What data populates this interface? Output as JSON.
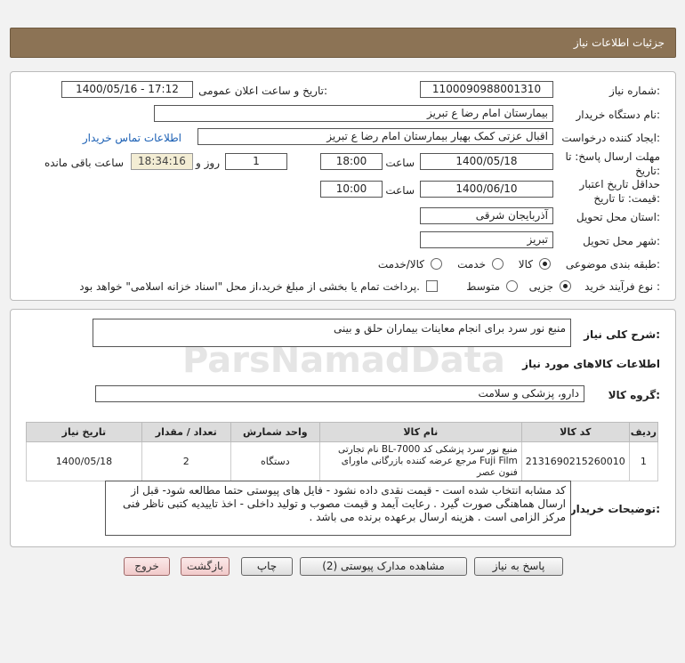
{
  "header": {
    "title": "جزئیات اطلاعات نیاز"
  },
  "watermark": {
    "text": "ParsNamadData"
  },
  "form": {
    "need_number": {
      "label": "شماره نیاز:",
      "value": "1100090988001310"
    },
    "announce_date": {
      "label": "تاریخ و ساعت اعلان عمومی:",
      "value": "1400/05/16 - 17:12"
    },
    "buyer_org": {
      "label": "نام دستگاه خریدار:",
      "value": "بیمارستان امام رضا  ع  تبریز"
    },
    "requester": {
      "label": "ایجاد کننده درخواست:",
      "value": "اقبال عزتی کمک بهیار بیمارستان امام رضا  ع  تبریز",
      "contact_link": "اطلاعات تماس خریدار"
    },
    "deadline": {
      "label": "مهلت ارسال پاسخ: تا تاریخ:",
      "date": "1400/05/18",
      "time_label": "ساعت",
      "time": "18:00",
      "days": "1",
      "days_label": "روز و",
      "remaining": "18:34:16",
      "remaining_label": "ساعت باقی مانده"
    },
    "validity": {
      "label": "حداقل تاریخ اعتبار قیمت: تا تاریخ:",
      "date": "1400/06/10",
      "time_label": "ساعت",
      "time": "10:00"
    },
    "province": {
      "label": "استان محل تحویل:",
      "value": "آذربایجان شرقی"
    },
    "city": {
      "label": "شهر محل تحویل:",
      "value": "تبریز"
    },
    "category": {
      "label": "طبقه بندی موضوعی:",
      "options": [
        "کالا",
        "خدمت",
        "کالا/خدمت"
      ],
      "selected": "کالا"
    },
    "process": {
      "label": "نوع فرآیند خرید :",
      "options": [
        "جزیی",
        "متوسط"
      ],
      "selected": "جزیی",
      "checkbox_text": "پرداخت تمام یا بخشی از مبلغ خرید،از محل \"اسناد خزانه اسلامی\" خواهد بود."
    }
  },
  "summary": {
    "label": "شرح کلی نیاز:",
    "value": "منبع نور سرد برای انجام معاینات بیماران حلق و بینی"
  },
  "goods_section_title": "اطلاعات کالاهای مورد نیاز",
  "goods_group": {
    "label": "گروه کالا:",
    "value": "دارو، پزشکی و سلامت"
  },
  "table": {
    "headers": [
      "ردیف",
      "کد کالا",
      "نام کالا",
      "واحد شمارش",
      "تعداد / مقدار",
      "تاریخ نیاز"
    ],
    "rows": [
      {
        "row": "1",
        "code": "2131690215260010",
        "name": "منبع نور سرد پزشکی کد BL-7000 نام تجارتی Fuji Film مرجع عرضه کننده بازرگانی ماورای فنون عصر",
        "unit": "دستگاه",
        "qty": "2",
        "date": "1400/05/18"
      }
    ]
  },
  "buyer_notes": {
    "label": "توضیحات خریدار:",
    "value": "کد مشابه انتخاب شده است - قیمت نقدی داده نشود - فایل های پیوستی حتما مطالعه شود- قبل از ارسال هماهنگی صورت گیرد . رعایت آیمد و قیمت مصوب و تولید داخلی -  اخذ تاییدیه کتبی ناظر فنی مرکز الزامی است . هزینه ارسال برعهده برنده می باشد ."
  },
  "buttons": {
    "reply": "پاسخ به نیاز",
    "attachments": "مشاهده مدارک پیوستی (2)",
    "print": "چاپ",
    "back": "بازگشت",
    "exit": "خروج"
  }
}
